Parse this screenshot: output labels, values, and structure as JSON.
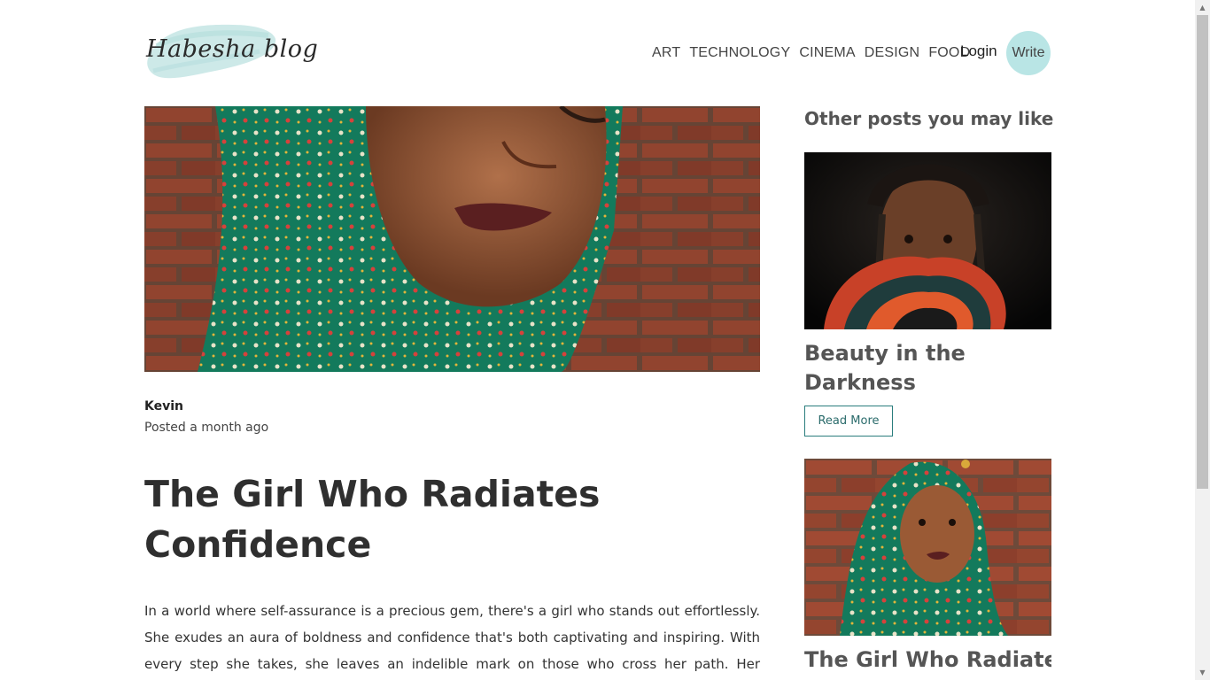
{
  "header": {
    "logo_text": "Habesha blog",
    "nav": [
      "ART",
      "TECHNOLOGY",
      "CINEMA",
      "DESIGN",
      "FOOD"
    ],
    "login_label": "Login",
    "write_label": "Write",
    "accent_color": "#b9e5e5"
  },
  "post": {
    "author": "Kevin",
    "posted": "Posted a month ago",
    "title": "The Girl Who Radiates Confidence",
    "body": "In a world where self-assurance is a precious gem, there's a girl who stands out effortlessly. She exudes an aura of boldness and confidence that's both captivating and inspiring. With every step she takes, she leaves an indelible mark on those who cross her path. Her posture"
  },
  "sidebar": {
    "heading": "Other posts you may like",
    "posts": [
      {
        "title": "Beauty in the Darkness",
        "button": "Read More"
      },
      {
        "title": "The Girl Who Radiates Confidence"
      }
    ]
  },
  "scrollbar": {
    "up_icon": "triangle-up",
    "down_icon": "triangle-down"
  }
}
